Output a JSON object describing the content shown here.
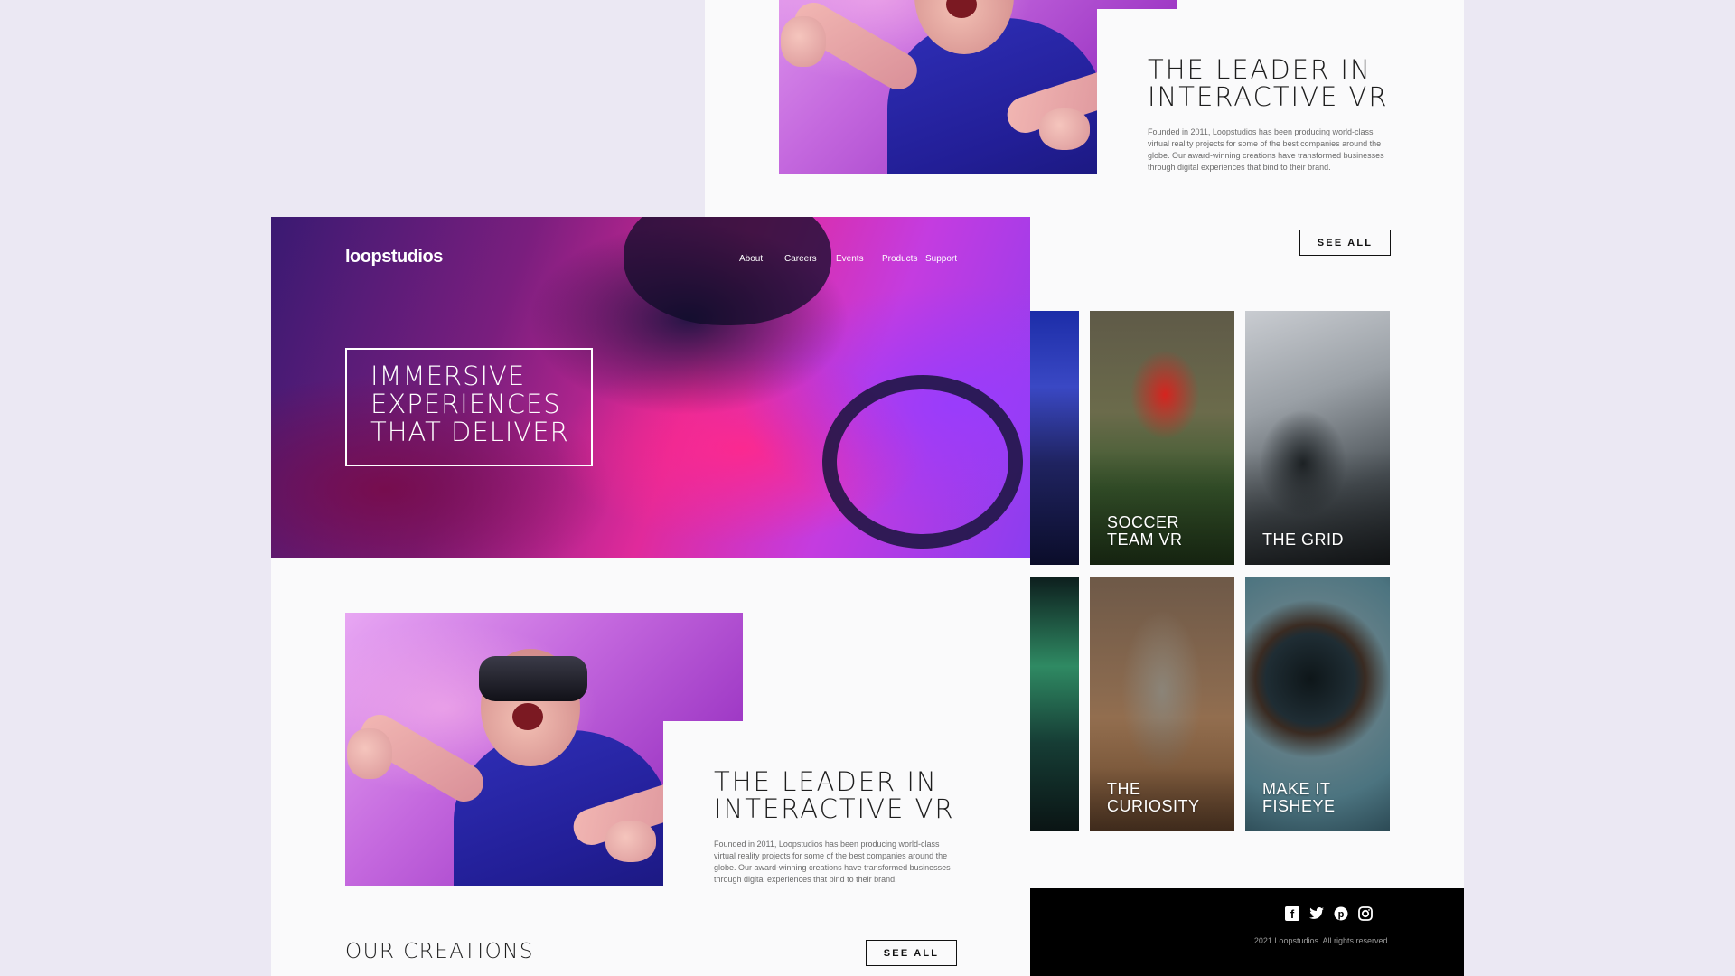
{
  "back_page": {
    "leader": {
      "title": "THE LEADER IN INTERACTIVE VR",
      "text": "Founded in 2011, Loopstudios has been producing world-class virtual reality projects for some of the best companies around the globe. Our award-winning creations have transformed businesses through digital experiences that bind to their brand."
    },
    "see_all_label": "SEE ALL",
    "creations": [
      {
        "label": "SOCCER TEAM VR"
      },
      {
        "label": "THE GRID"
      },
      {
        "label": "THE CURIOSITY"
      },
      {
        "label": "MAKE IT FISHEYE"
      }
    ],
    "footer": {
      "social": [
        "facebook-icon",
        "twitter-icon",
        "pinterest-icon",
        "instagram-icon"
      ],
      "copyright": "2021 Loopstudios. All rights reserved."
    }
  },
  "front_page": {
    "logo": "loopstudios",
    "nav": [
      "About",
      "Careers",
      "Events",
      "Products",
      "Support"
    ],
    "hero_title": "IMMERSIVE EXPERIENCES THAT DELIVER",
    "leader": {
      "title": "THE LEADER IN INTERACTIVE VR",
      "text": "Founded in 2011, Loopstudios has been producing world-class virtual reality projects for some of the best companies around the globe. Our award-winning creations have transformed businesses through digital experiences that bind to their brand."
    },
    "creations_title": "OUR CREATIONS",
    "see_all_label": "SEE ALL"
  },
  "colors": {
    "background": "#ebe8f3",
    "page": "#fafafb",
    "text_dark": "#1d1d1d",
    "text_muted": "#6b6b6b",
    "footer": "#000000"
  }
}
